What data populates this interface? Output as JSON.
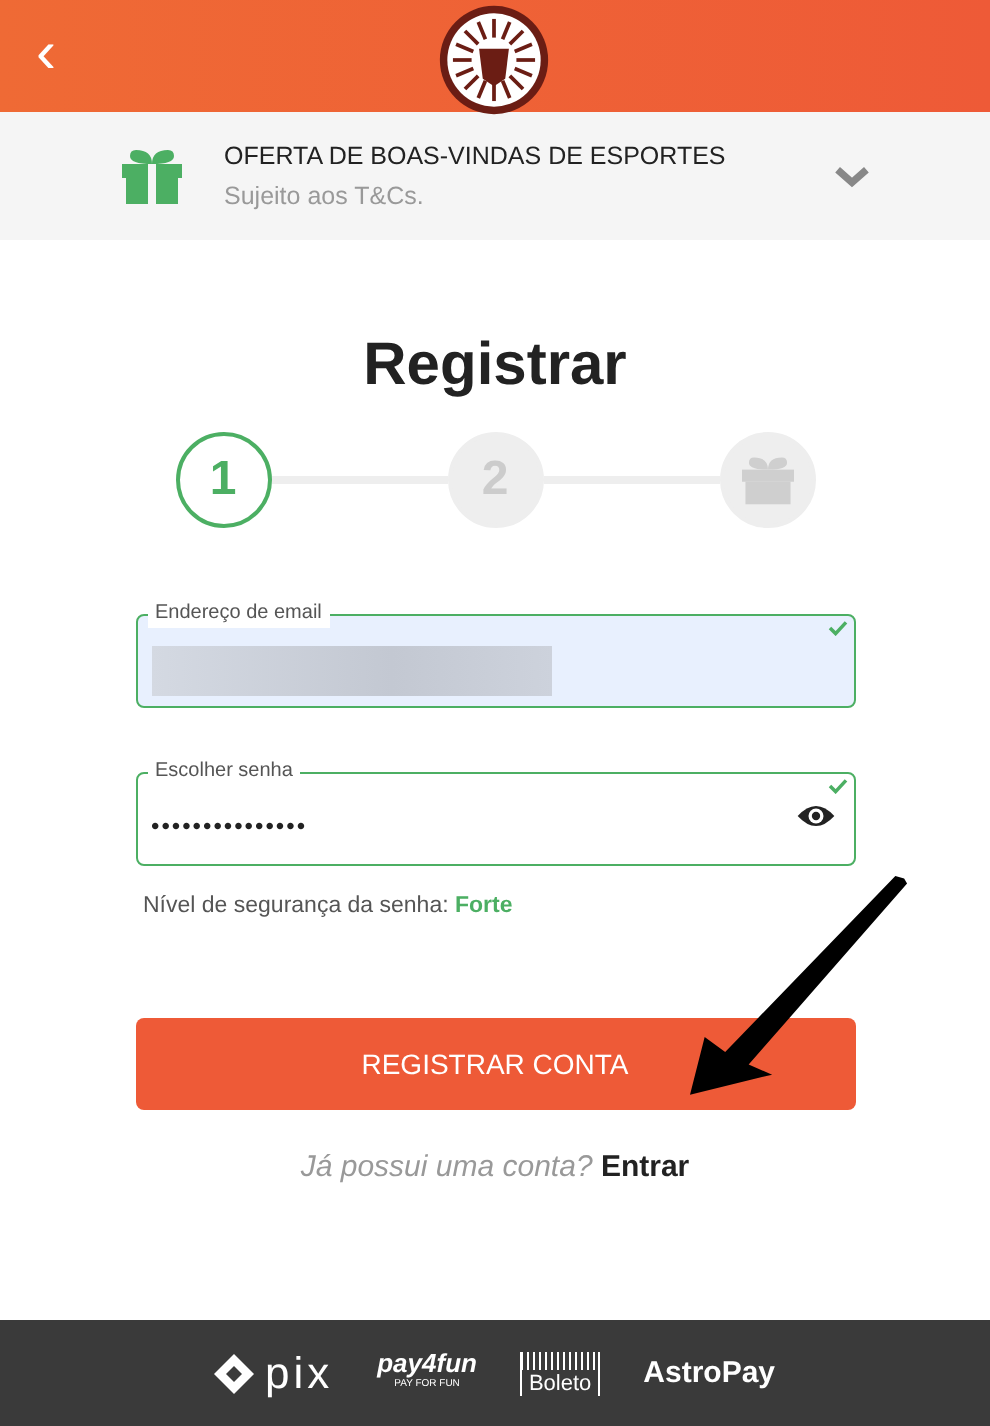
{
  "header": {
    "back_icon": "‹"
  },
  "promo": {
    "title": "OFERTA DE BOAS-VINDAS DE ESPORTES",
    "note": "Sujeito aos T&Cs.",
    "expanded": false
  },
  "heading": "Registrar",
  "steps": [
    {
      "kind": "number",
      "label": "1",
      "selected": true
    },
    {
      "kind": "number",
      "label": "2",
      "selected": false
    },
    {
      "kind": "gift",
      "selected": false
    }
  ],
  "fields": [
    {
      "kind": "email",
      "label": "Endereço de email",
      "valid": true,
      "redacted": true
    },
    {
      "kind": "password",
      "label": "Escolher senha",
      "value": "•••••••••••••••",
      "valid": true
    }
  ],
  "strength": {
    "label": "Nível de segurança da senha:",
    "value": "Forte"
  },
  "submit": "REGISTRAR CONTA",
  "login": {
    "question": "Já possui uma conta?",
    "link": "Entrar"
  },
  "payments": [
    {
      "kind": "pix",
      "name": "pix"
    },
    {
      "kind": "pay4fun",
      "name": "pay4fun",
      "sub": "PAY FOR FUN"
    },
    {
      "kind": "boleto",
      "name": "Boleto"
    },
    {
      "kind": "astropay",
      "name": "AstroPay"
    }
  ]
}
